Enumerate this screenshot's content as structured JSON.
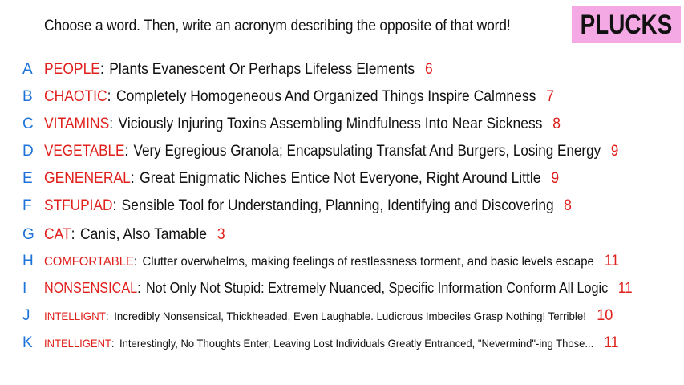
{
  "prompt": "Choose a word. Then, write an acronym describing the opposite of that word!",
  "logo": "PLUCKS",
  "colors": {
    "letter": "#1e73d8",
    "word": "#e0201c",
    "count": "#e0201c",
    "logo_bg": "#f4a9e4"
  },
  "entries": [
    {
      "letter": "A",
      "word": "PEOPLE",
      "colon": ":",
      "phrase": "Plants Evanescent Or Perhaps Lifeless Elements",
      "count": "6"
    },
    {
      "letter": "B",
      "word": "CHAOTIC",
      "colon": ":",
      "phrase": "Completely Homogeneous And Organized Things Inspire Calmness",
      "count": "7"
    },
    {
      "letter": "C",
      "word": "VITAMINS",
      "colon": ":",
      "phrase": "Viciously Injuring Toxins Assembling Mindfulness Into Near Sickness",
      "count": "8"
    },
    {
      "letter": "D",
      "word": "VEGETABLE",
      "colon": ":",
      "phrase": "Very Egregious Granola; Encapsulating Transfat And Burgers, Losing Energy",
      "count": "9"
    },
    {
      "letter": "E",
      "word": "GENENERAL",
      "colon": ":",
      "phrase": "Great Enigmatic Niches Entice Not Everyone, Right Around Little",
      "count": "9"
    },
    {
      "letter": "F",
      "word": "STFUPIAD",
      "colon": ":",
      "phrase": "Sensible Tool for Understanding, Planning, Identifying and Discovering",
      "count": "8"
    },
    {
      "letter": "G",
      "word": "CAT",
      "colon": ":",
      "phrase": "Canis, Also Tamable",
      "count": "3"
    },
    {
      "letter": "H",
      "word": "COMFORTABLE",
      "colon": ":",
      "phrase": "Clutter overwhelms, making feelings of restlessness torment, and basic levels escape",
      "count": "11"
    },
    {
      "letter": "I",
      "word": "NONSENSICAL",
      "colon": ":",
      "phrase": "Not Only Not Stupid: Extremely Nuanced, Specific Information Conform All Logic",
      "count": "11"
    },
    {
      "letter": "J",
      "word": "INTELLIGNT",
      "colon": ":",
      "phrase": "Incredibly Nonsensical, Thickheaded, Even Laughable. Ludicrous Imbeciles Grasp Nothing! Terrible!",
      "count": "10"
    },
    {
      "letter": "K",
      "word": "INTELLIGENT",
      "colon": ":",
      "phrase": "Interestingly, No Thoughts Enter, Leaving Lost Individuals Greatly Entranced, \"Nevermind\"-ing Those...",
      "count": "11"
    }
  ]
}
